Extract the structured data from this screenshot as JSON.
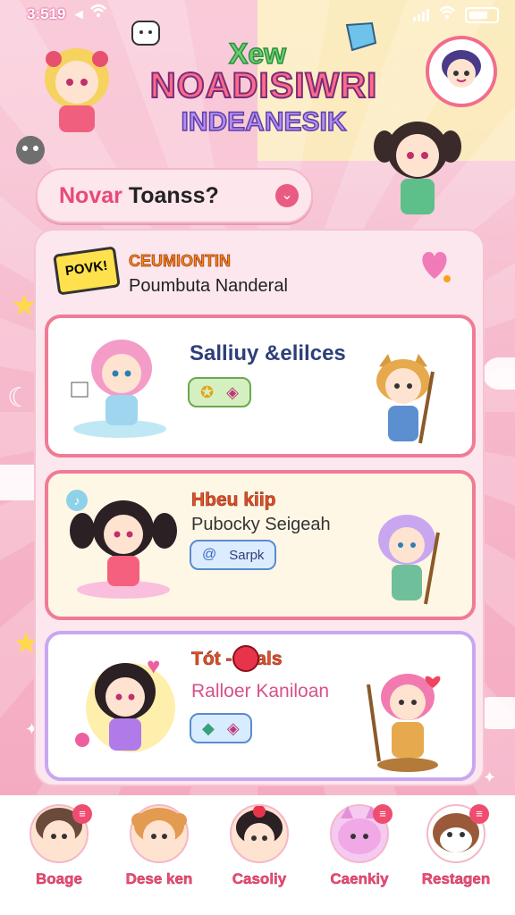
{
  "status_bar": {
    "time": "3:519"
  },
  "header": {
    "title_top": "Xew",
    "title_main": "NOADISIWRI",
    "title_sub": "INDEANESIK"
  },
  "search": {
    "label_pink": "Novar",
    "label_dark": " Toanss?"
  },
  "notice": {
    "bubble": "POVK!",
    "title": "CEUMIONTIN",
    "subtitle": "Poumbuta Nanderal"
  },
  "cards": [
    {
      "title": "Salliuy &elilces",
      "subtitle": "",
      "chip_icons": [
        "star-icon",
        "cube-icon"
      ],
      "title_color": "#2d3f7a"
    },
    {
      "title": "Hbeu kiip",
      "subtitle": "Pubocky Seigeah",
      "chip_label": "Sarpk",
      "title_color": "#e0502a"
    },
    {
      "title": "Tót -Ccals",
      "subtitle": "Ralloer Kaniloan",
      "chip_icons": [
        "leaf-icon",
        "cube-icon"
      ],
      "title_color": "#e0502a"
    }
  ],
  "nav": [
    {
      "label": "Boage",
      "badge": "≡"
    },
    {
      "label": "Dese ken",
      "badge": ""
    },
    {
      "label": "Casoliy",
      "badge": ""
    },
    {
      "label": "Caenkiy",
      "badge": "≡"
    },
    {
      "label": "Restagen",
      "badge": "≡"
    }
  ],
  "colors": {
    "accent": "#ef4d6f",
    "panel": "#fbe7ed",
    "card3_border": "#c9a7f0"
  }
}
